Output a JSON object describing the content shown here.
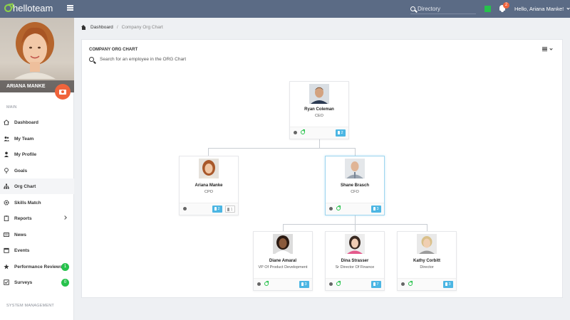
{
  "topbar": {
    "logo": "helloteam",
    "directory_placeholder": "Directory",
    "notification_count": "2",
    "user_greeting": "Hello, Ariana Manke!"
  },
  "sidebar": {
    "profile_name": "ARIANA MANKE",
    "section_main": "MAIN",
    "items": [
      {
        "label": "Dashboard",
        "icon": "home-icon"
      },
      {
        "label": "My Team",
        "icon": "users-icon"
      },
      {
        "label": "My Profile",
        "icon": "user-icon"
      },
      {
        "label": "Goals",
        "icon": "pin-icon"
      },
      {
        "label": "Org Chart",
        "icon": "sitemap-icon",
        "active": true
      },
      {
        "label": "Skills Match",
        "icon": "gear-icon"
      },
      {
        "label": "Reports",
        "icon": "clipboard-icon",
        "has_submenu": true
      },
      {
        "label": "News",
        "icon": "news-icon"
      },
      {
        "label": "Events",
        "icon": "calendar-icon"
      },
      {
        "label": "Performance Reviews",
        "icon": "star-icon",
        "badge": "1"
      },
      {
        "label": "Surveys",
        "icon": "checkbox-icon",
        "badge": "0"
      }
    ],
    "section_system": "SYSTEM MANAGEMENT"
  },
  "breadcrumb": {
    "root": "Dashboard",
    "separator": "/",
    "current": "Company Org Chart"
  },
  "panel": {
    "title": "COMPANY ORG CHART",
    "search_placeholder": "Search for an employee in the ORG Chart"
  },
  "org": {
    "ceo": {
      "name": "Ryan Coleman",
      "title": "CEO",
      "reports": "2"
    },
    "cpo": {
      "name": "Ariana Manke",
      "title": "CPO",
      "reports": "2",
      "secondary": "1"
    },
    "cfo": {
      "name": "Shane Brasch",
      "title": "CFO",
      "reports": "3"
    },
    "vp": {
      "name": "Diane Amaral",
      "title": "VP Of Product Development",
      "reports": "3"
    },
    "dir_fin": {
      "name": "Dina Strasser",
      "title": "Sr Director Of Finance",
      "reports": "7"
    },
    "director": {
      "name": "Kathy Corbitt",
      "title": "Director",
      "reports": "3"
    }
  },
  "colors": {
    "topbar": "#5b6b85",
    "accent_orange": "#f0643c",
    "badge_green": "#27c24c",
    "count_blue": "#4cb6e3"
  }
}
